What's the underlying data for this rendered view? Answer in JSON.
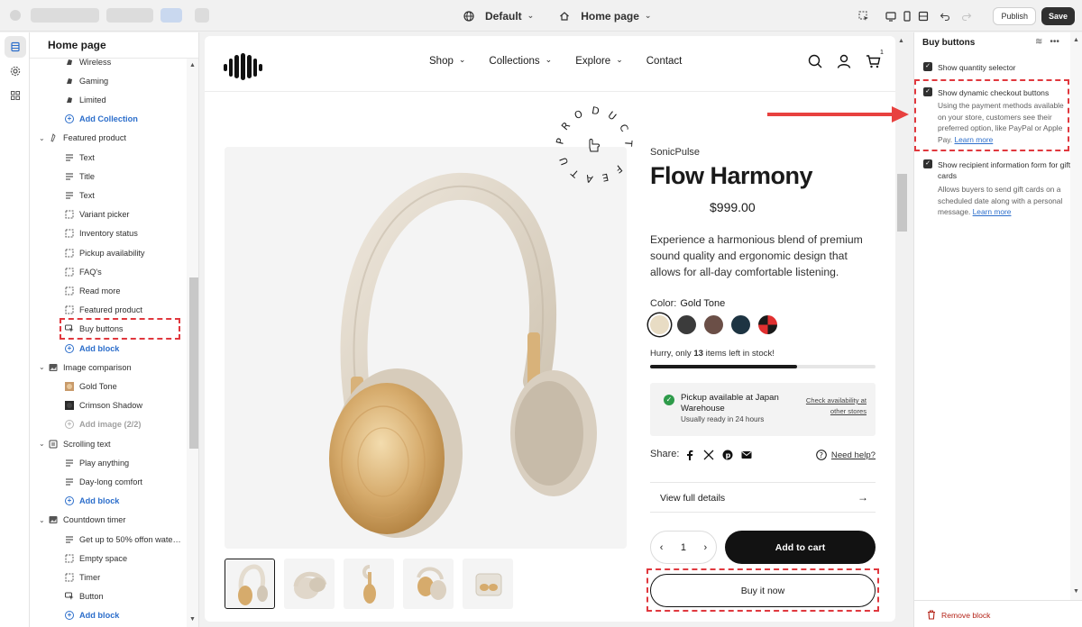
{
  "topbar": {
    "theme_select": "Default",
    "page_select": "Home page",
    "publish_label": "Publish",
    "save_label": "Save"
  },
  "sidebar": {
    "title": "Home page",
    "rows": [
      {
        "label": "Wireless",
        "kind": "item",
        "icon": "product-icon"
      },
      {
        "label": "Gaming",
        "kind": "item",
        "icon": "product-icon"
      },
      {
        "label": "Limited",
        "kind": "item",
        "icon": "product-icon"
      },
      {
        "label": "Add Collection",
        "kind": "add"
      },
      {
        "label": "Featured product",
        "kind": "section",
        "icon": "tag-icon"
      },
      {
        "label": "Text",
        "kind": "item",
        "icon": "text-icon"
      },
      {
        "label": "Title",
        "kind": "item",
        "icon": "text-icon"
      },
      {
        "label": "Text",
        "kind": "item",
        "icon": "text-icon"
      },
      {
        "label": "Variant picker",
        "kind": "item",
        "icon": "frame-icon"
      },
      {
        "label": "Inventory status",
        "kind": "item",
        "icon": "frame-icon"
      },
      {
        "label": "Pickup availability",
        "kind": "item",
        "icon": "frame-icon"
      },
      {
        "label": "FAQ's",
        "kind": "item",
        "icon": "frame-icon"
      },
      {
        "label": "Read more",
        "kind": "item",
        "icon": "frame-icon"
      },
      {
        "label": "Featured product",
        "kind": "item",
        "icon": "frame-icon"
      },
      {
        "label": "Buy buttons",
        "kind": "item",
        "icon": "cursor-icon"
      },
      {
        "label": "Add block",
        "kind": "add"
      },
      {
        "label": "Image comparison",
        "kind": "section",
        "icon": "image-icon"
      },
      {
        "label": "Gold Tone",
        "kind": "item",
        "icon": "gold-thumb-icon"
      },
      {
        "label": "Crimson Shadow",
        "kind": "item",
        "icon": "dark-thumb-icon"
      },
      {
        "label": "Add image (2/2)",
        "kind": "add-disabled"
      },
      {
        "label": "Scrolling text",
        "kind": "section",
        "icon": "layout-icon"
      },
      {
        "label": "Play anything",
        "kind": "item",
        "icon": "text-icon"
      },
      {
        "label": "Day-long comfort",
        "kind": "item",
        "icon": "text-icon"
      },
      {
        "label": "Add block",
        "kind": "add"
      },
      {
        "label": "Countdown timer",
        "kind": "section",
        "icon": "image-icon"
      },
      {
        "label": "Get up to 50% offon waterpr...",
        "kind": "item",
        "icon": "text-icon"
      },
      {
        "label": "Empty space",
        "kind": "item",
        "icon": "frame-icon"
      },
      {
        "label": "Timer",
        "kind": "item",
        "icon": "frame-icon"
      },
      {
        "label": "Button",
        "kind": "item",
        "icon": "cursor-icon"
      },
      {
        "label": "Add block",
        "kind": "add"
      }
    ]
  },
  "store": {
    "nav": [
      {
        "label": "Shop",
        "dropdown": true
      },
      {
        "label": "Collections",
        "dropdown": true
      },
      {
        "label": "Explore",
        "dropdown": true
      },
      {
        "label": "Contact",
        "dropdown": false
      }
    ],
    "cart_count": "1",
    "badge_text": "PRODUCT FEATURED",
    "vendor": "SonicPulse",
    "title": "Flow Harmony",
    "price": "$999.00",
    "description": "Experience a harmonious blend of premium sound quality and ergonomic design that allows for all-day comfortable listening.",
    "color_label": "Color:",
    "color_value": "Gold Tone",
    "swatches": [
      "#e8dcc4",
      "#3b3b3b",
      "#6b4f47",
      "#1d3442",
      "split"
    ],
    "stock_prefix": "Hurry, only ",
    "stock_count": "13",
    "stock_suffix": " items left in stock!",
    "stock_level": 0.65,
    "pickup_title": "Pickup available at Japan Warehouse",
    "pickup_sub": "Usually ready in 24 hours",
    "pickup_link": "Check availability at other stores",
    "share_label": "Share:",
    "help_label": "Need help?",
    "details_label": "View full details",
    "qty": "1",
    "add_to_cart": "Add to cart",
    "buy_now": "Buy it now"
  },
  "settings": {
    "title": "Buy buttons",
    "opt1_label": "Show quantity selector",
    "opt2_label": "Show dynamic checkout buttons",
    "opt2_help": "Using the payment methods available on your store, customers see their preferred option, like PayPal or Apple Pay.",
    "opt2_link": "Learn more",
    "opt3_label": "Show recipient information form for gift cards",
    "opt3_help": "Allows buyers to send gift cards on a scheduled date along with a personal message.",
    "opt3_link": "Learn more",
    "remove_label": "Remove block"
  },
  "colors": {
    "accent": "#2c6ecb",
    "highlight": "#e0383e",
    "primary_button": "#121212"
  }
}
